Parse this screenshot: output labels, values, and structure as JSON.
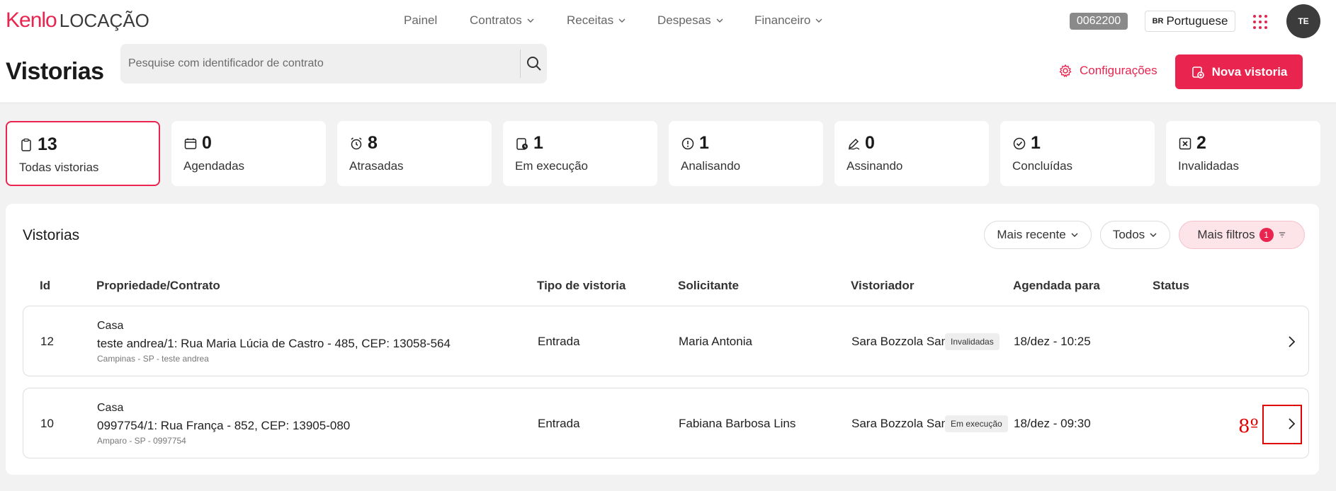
{
  "header": {
    "logo_brand": "Kenlo",
    "logo_product": "LOCAÇÃO",
    "nav": [
      {
        "label": "Painel",
        "dropdown": false
      },
      {
        "label": "Contratos",
        "dropdown": true
      },
      {
        "label": "Receitas",
        "dropdown": true
      },
      {
        "label": "Despesas",
        "dropdown": true
      },
      {
        "label": "Financeiro",
        "dropdown": true
      }
    ],
    "account_code": "0062200",
    "language_flag": "BR",
    "language": "Portuguese",
    "avatar_initials": "TE"
  },
  "page": {
    "title": "Vistorias",
    "search_placeholder": "Pesquise com identificador de contrato",
    "config_label": "Configurações",
    "new_button_label": "Nova vistoria"
  },
  "stats": [
    {
      "count": "13",
      "label": "Todas vistorias",
      "icon": "clipboard-icon",
      "active": true
    },
    {
      "count": "0",
      "label": "Agendadas",
      "icon": "calendar-icon",
      "active": false
    },
    {
      "count": "8",
      "label": "Atrasadas",
      "icon": "alarm-icon",
      "active": false
    },
    {
      "count": "1",
      "label": "Em execução",
      "icon": "clipboard-clock-icon",
      "active": false
    },
    {
      "count": "1",
      "label": "Analisando",
      "icon": "alert-circle-icon",
      "active": false
    },
    {
      "count": "0",
      "label": "Assinando",
      "icon": "signature-icon",
      "active": false
    },
    {
      "count": "1",
      "label": "Concluídas",
      "icon": "check-circle-icon",
      "active": false
    },
    {
      "count": "2",
      "label": "Invalidadas",
      "icon": "x-square-icon",
      "active": false
    }
  ],
  "list": {
    "title": "Vistorias",
    "sort_label": "Mais recente",
    "filter_all_label": "Todos",
    "more_filters_label": "Mais filtros",
    "more_filters_count": "1",
    "columns": [
      "Id",
      "Propriedade/Contrato",
      "Tipo de vistoria",
      "Solicitante",
      "Vistoriador",
      "Agendada para",
      "Status"
    ],
    "rows": [
      {
        "id": "12",
        "property_type": "Casa",
        "address": "teste andrea/1: Rua Maria Lúcia de Castro - 485, CEP: 13058-564",
        "location": "Campinas - SP - teste andrea",
        "tipo": "Entrada",
        "solicitante": "Maria Antonia",
        "vistoriador": "Sara Bozzola Santo",
        "agendada": "18/dez - 10:25",
        "status": "Invalidadas"
      },
      {
        "id": "10",
        "property_type": "Casa",
        "address": "0997754/1: Rua França - 852, CEP: 13905-080",
        "location": "Amparo - SP - 0997754",
        "tipo": "Entrada",
        "solicitante": "Fabiana Barbosa Lins",
        "vistoriador": "Sara Bozzola Santo",
        "agendada": "18/dez - 09:30",
        "status": "Em execução"
      }
    ]
  },
  "annotation": {
    "note": "8º",
    "color": "#e00000"
  },
  "colors": {
    "accent": "#e8244f"
  }
}
